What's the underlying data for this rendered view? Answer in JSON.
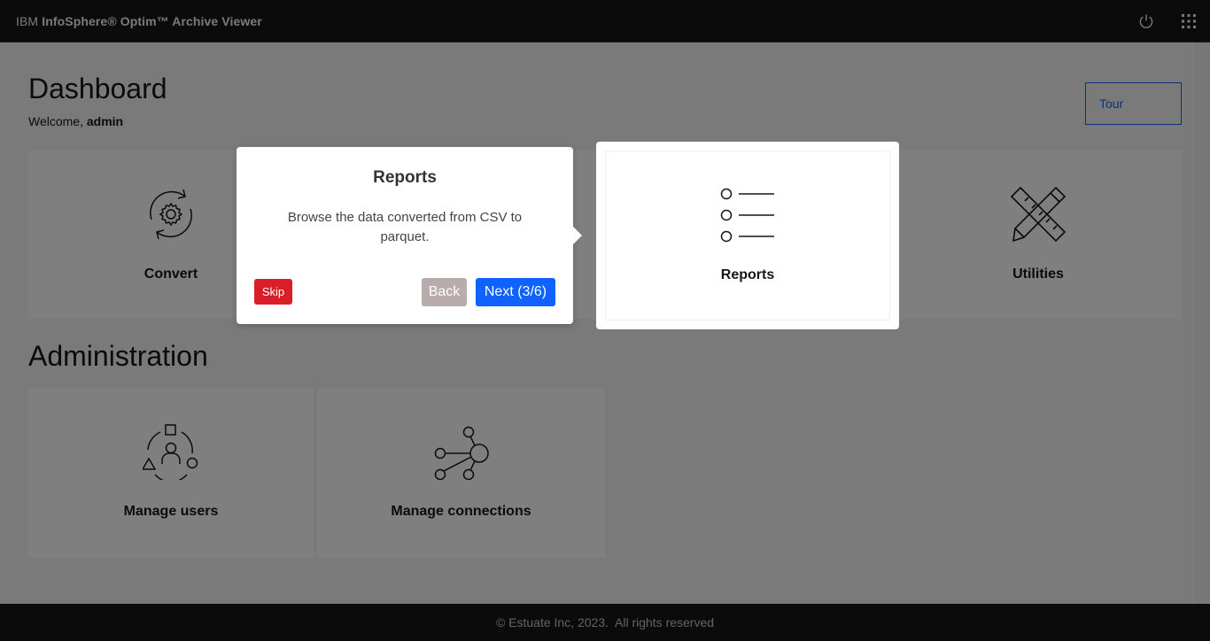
{
  "header": {
    "brand_prefix": "IBM",
    "brand_name": "InfoSphere® Optim™ Archive Viewer",
    "power_icon": "power-icon",
    "switcher_icon": "app-switcher-icon"
  },
  "dashboard": {
    "title": "Dashboard",
    "welcome_prefix": "Welcome,",
    "welcome_user": "admin",
    "tour_label": "Tour",
    "tiles": [
      {
        "label": "Convert",
        "icon": "convert-gear-icon"
      },
      {
        "label": "",
        "icon": ""
      },
      {
        "label": "Reports",
        "icon": "list-icon"
      },
      {
        "label": "Utilities",
        "icon": "tools-icon"
      }
    ]
  },
  "administration": {
    "title": "Administration",
    "tiles": [
      {
        "label": "Manage users",
        "icon": "user-group-icon"
      },
      {
        "label": "Manage connections",
        "icon": "network-icon"
      }
    ]
  },
  "tour_popover": {
    "title": "Reports",
    "description": "Browse the data converted from CSV to parquet.",
    "skip_label": "Skip",
    "back_label": "Back",
    "next_label": "Next (3/6)"
  },
  "footer": {
    "text": "© Estuate Inc, 2023.  All rights reserved"
  },
  "colors": {
    "header_bg": "#161616",
    "accent": "#0f62fe",
    "skip": "#da1e28",
    "back": "#b9acac"
  }
}
